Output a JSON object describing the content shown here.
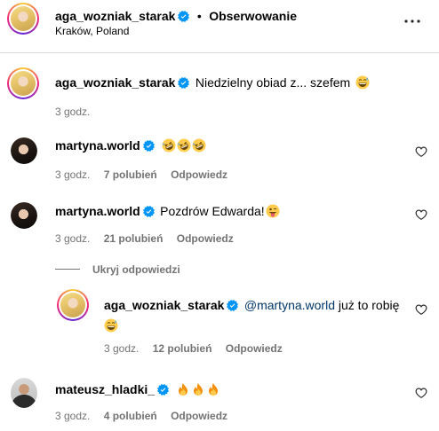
{
  "header": {
    "username": "aga_wozniak_starak",
    "bullet": "•",
    "follow_label": "Obserwowanie",
    "location": "Kraków, Poland",
    "more_icon": "more-horizontal-icon"
  },
  "comments": [
    {
      "username": "aga_wozniak_starak",
      "text": "Niedzielny obiad z... szefem",
      "emoji": [
        "grin-sweat"
      ],
      "time": "3 godz."
    },
    {
      "username": "martyna.world",
      "text": "",
      "emoji": [
        "rofl",
        "rofl",
        "rofl"
      ],
      "time": "3 godz.",
      "likes": "7 polubień",
      "reply": "Odpowiedz"
    },
    {
      "username": "martyna.world",
      "text": "Pozdrów Edwarda!",
      "emoji": [
        "tongue-wink"
      ],
      "time": "3 godz.",
      "likes": "21 polubień",
      "reply": "Odpowiedz"
    },
    {
      "toggle": "Ukryj odpowiedzi"
    },
    {
      "username": "aga_wozniak_starak",
      "mention": "@martyna.world",
      "text": " już to robię",
      "emoji": [
        "grin-sweat"
      ],
      "time": "3 godz.",
      "likes": "12 polubień",
      "reply": "Odpowiedz"
    },
    {
      "username": "mateusz_hladki_",
      "text": "",
      "emoji": [
        "fire",
        "fire",
        "fire"
      ],
      "time": "3 godz.",
      "likes": "4 polubień",
      "reply": "Odpowiedz"
    }
  ],
  "colors": {
    "verified": "#0095f6",
    "meta": "#737373",
    "mention": "#00376b",
    "divider": "#dbdbdb"
  }
}
